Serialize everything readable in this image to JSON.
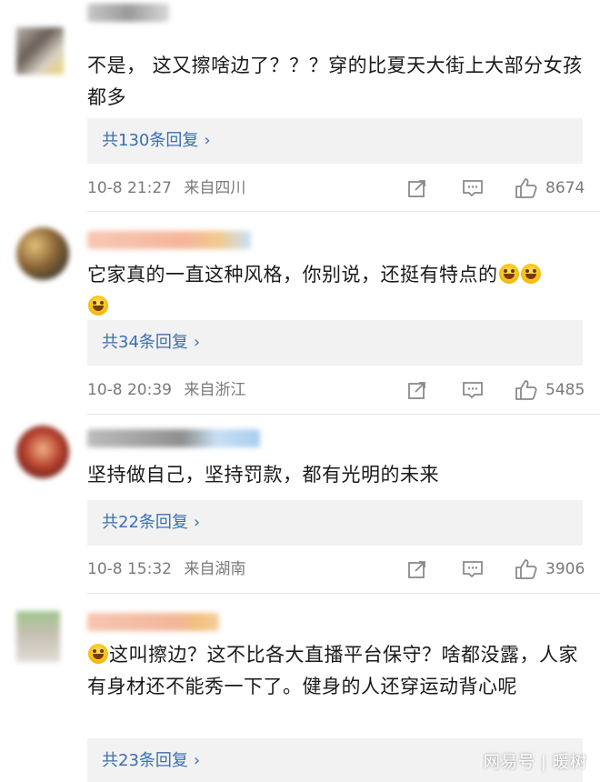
{
  "comments": [
    {
      "text": "不是， 这又擦啥边了？？？穿的比夏天大街上大部分女孩都多",
      "replies_label": "共130条回复",
      "time": "10-8 21:27",
      "source": "来自四川",
      "likes": "8674"
    },
    {
      "text": "它家真的一直这种风格，你别说，还挺有特点的",
      "replies_label": "共34条回复",
      "time": "10-8 20:39",
      "source": "来自浙江",
      "likes": "5485"
    },
    {
      "text": "坚持做自己，坚持罚款，都有光明的未来",
      "replies_label": "共22条回复",
      "time": "10-8 15:32",
      "source": "来自湖南",
      "likes": "3906"
    },
    {
      "text": "这叫擦边？这不比各大直播平台保守？啥都没露，人家有身材还不能秀一下了。健身的人还穿运动背心呢",
      "replies_label": "共23条回复"
    }
  ],
  "chevron": "›",
  "icons": {
    "share": "share-icon",
    "comment": "comment-icon",
    "like": "thumbs-up-icon",
    "emoji": "laughing-emoji-icon"
  },
  "colors": {
    "reply_link": "#3a6fb0",
    "reply_bg": "#f2f2f2",
    "meta": "#7a7a7a"
  },
  "watermark": {
    "brand": "网易号",
    "author": "暖树"
  }
}
